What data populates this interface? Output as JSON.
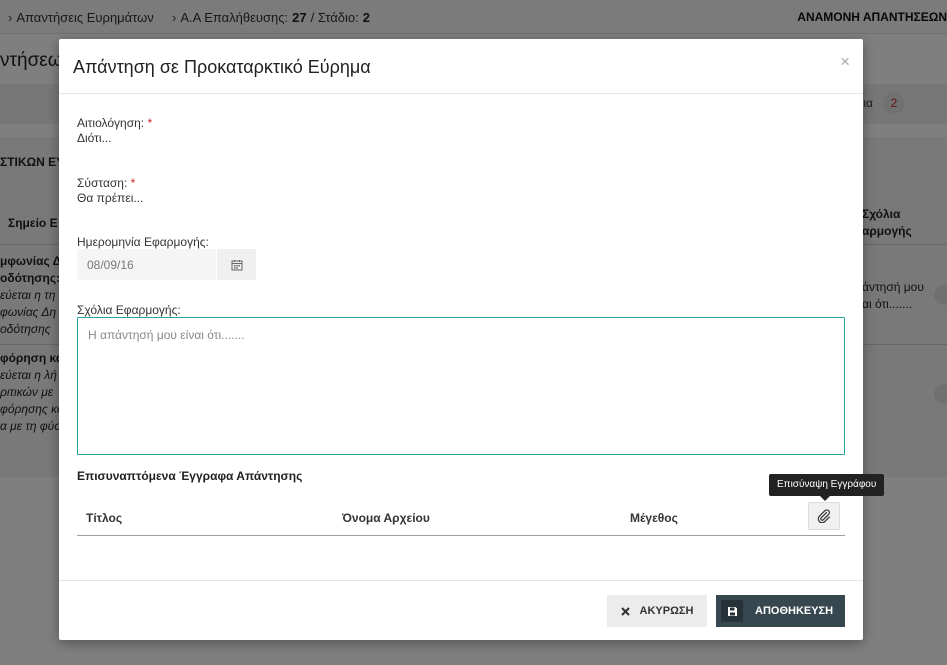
{
  "topbar": {
    "crumb1": "Απαντήσεις Ευρημάτων",
    "crumb2_prefix": "Α.Α Επαλήθευσης:",
    "crumb2_num": "27",
    "crumb2_mid": " / Στάδιο:",
    "crumb2_stage": "2",
    "status": "ΑΝΑΜΟΝΗ ΑΠΑΝΤΗΣΕΩΝ"
  },
  "background": {
    "page_title": "ντήσεων",
    "tab_right": "ια",
    "tab_count": "2",
    "section_title": "ΣΤΙΚΩΝ ΕΥ",
    "th_left": "Σημείο Ε",
    "th_right_1": "Σχόλια",
    "th_right_2": "αρμογής",
    "row1": [
      "μφωνίας Δ",
      "οδότησης:",
      "εύεται η τη",
      "φωνίας Δη",
      "οδότησης"
    ],
    "row1_right": [
      "άντησή μου",
      "αι ότι......."
    ],
    "row2": [
      "φόρηση και",
      "εύεται η λή",
      "ριτικών με",
      "φόρησης κα",
      "α με τη φύσ"
    ]
  },
  "modal": {
    "title": "Απάντηση σε Προκαταρκτικό Εύρημα",
    "close": "×",
    "justification_label": "Αιτιολόγηση:",
    "justification_value": "Διότι...",
    "recommendation_label": "Σύσταση:",
    "recommendation_value": "Θα πρέπει...",
    "required_mark": "*",
    "date_label": "Ημερομηνία Εφαρμογής:",
    "date_value": "08/09/16",
    "comments_label": "Σχόλια Εφαρμογής:",
    "comments_placeholder": "Η απάντησή μου είναι ότι.......",
    "attachments_title": "Επισυναπτόμενα Έγγραφα Απάντησης",
    "col_title": "Τίτλος",
    "col_filename": "Όνομα Αρχείου",
    "col_size": "Μέγεθος",
    "attach_tooltip": "Επισύναψη Εγγράφου",
    "cancel_label": "ΑΚΥΡΩΣΗ",
    "save_label": "ΑΠΟΘΗΚΕΥΣΗ"
  },
  "icons": {
    "calendar": "calendar-icon",
    "paperclip": "paperclip-icon",
    "close_x": "x-icon",
    "save": "floppy-icon"
  }
}
